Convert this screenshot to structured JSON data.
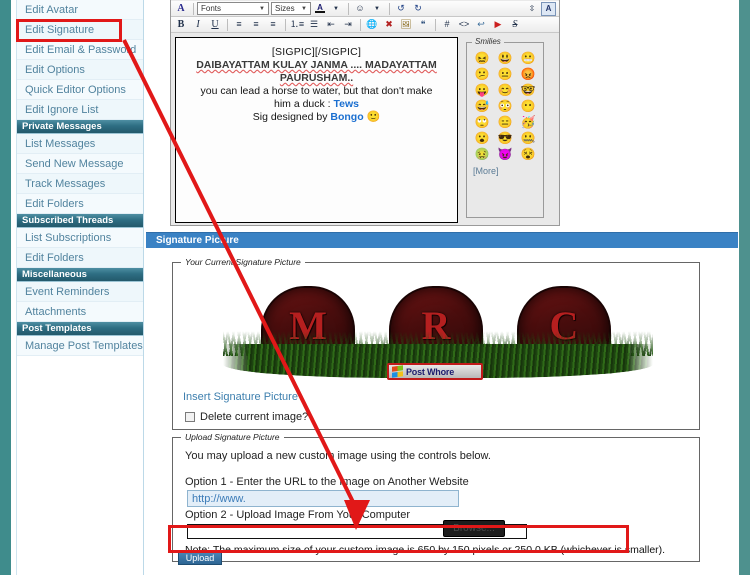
{
  "sidebar": {
    "items": [
      {
        "label": "Edit Avatar",
        "type": "item"
      },
      {
        "label": "Edit Signature",
        "type": "item"
      },
      {
        "label": "Edit Email & Password",
        "type": "item"
      },
      {
        "label": "Edit Options",
        "type": "item"
      },
      {
        "label": "Quick Editor Options",
        "type": "item"
      },
      {
        "label": "Edit Ignore List",
        "type": "item"
      },
      {
        "label": "Private Messages",
        "type": "head"
      },
      {
        "label": "List Messages",
        "type": "item"
      },
      {
        "label": "Send New Message",
        "type": "item"
      },
      {
        "label": "Track Messages",
        "type": "item"
      },
      {
        "label": "Edit Folders",
        "type": "item"
      },
      {
        "label": "Subscribed Threads",
        "type": "head"
      },
      {
        "label": "List Subscriptions",
        "type": "item"
      },
      {
        "label": "Edit Folders",
        "type": "item"
      },
      {
        "label": "Miscellaneous",
        "type": "head"
      },
      {
        "label": "Event Reminders",
        "type": "item"
      },
      {
        "label": "Attachments",
        "type": "item"
      },
      {
        "label": "Post Templates",
        "type": "head"
      },
      {
        "label": "Manage Post Templates",
        "type": "item"
      }
    ]
  },
  "editor": {
    "toolbar_row1": {
      "fonts_label": "Fonts",
      "sizes_label": "Sizes",
      "buttons": [
        {
          "name": "remove-formatting-icon",
          "glyph": "Ⓐ"
        },
        {
          "name": "font-color-icon",
          "glyph": "A"
        },
        {
          "name": "smilie-icon",
          "glyph": "☺"
        },
        {
          "name": "undo-icon",
          "glyph": "↶"
        },
        {
          "name": "redo-icon",
          "glyph": "↷"
        },
        {
          "name": "box-size-stepper-icon",
          "glyph": "↕"
        },
        {
          "name": "wysiwyg-toggle-icon",
          "glyph": "A"
        }
      ]
    },
    "toolbar_row2": {
      "buttons": [
        {
          "name": "bold-icon",
          "glyph": "B"
        },
        {
          "name": "italic-icon",
          "glyph": "I"
        },
        {
          "name": "underline-icon",
          "glyph": "U"
        },
        {
          "name": "align-left-icon",
          "glyph": "≡"
        },
        {
          "name": "align-center-icon",
          "glyph": "≡"
        },
        {
          "name": "align-right-icon",
          "glyph": "≡"
        },
        {
          "name": "ordered-list-icon",
          "glyph": "③"
        },
        {
          "name": "unordered-list-icon",
          "glyph": "☰"
        },
        {
          "name": "outdent-icon",
          "glyph": "⇤"
        },
        {
          "name": "indent-icon",
          "glyph": "⇥"
        },
        {
          "name": "insert-link-icon",
          "glyph": "🌎"
        },
        {
          "name": "remove-link-icon",
          "glyph": "✗"
        },
        {
          "name": "insert-image-icon",
          "glyph": "◱"
        },
        {
          "name": "insert-quote-icon",
          "glyph": "❐"
        },
        {
          "name": "hash-icon",
          "glyph": "#"
        },
        {
          "name": "code-icon",
          "glyph": "<>"
        },
        {
          "name": "wrap-icon",
          "glyph": "↩"
        },
        {
          "name": "youtube-icon",
          "glyph": "▶"
        },
        {
          "name": "strikethrough-icon",
          "glyph": "S"
        }
      ]
    },
    "signature": {
      "line_sigpic": "[SIGPIC][/SIGPIC]",
      "line_quote1": "DAIBAYATTAM KULAY JANMA .... MADAYATTAM",
      "line_quote2": "PAURUSHAM..",
      "line_saying1": "you can lead a horse to water, but that don't make",
      "line_saying2_pre": "him a duck : ",
      "line_saying2_link": "Tews",
      "line_credit_pre": "Sig designed by ",
      "line_credit_link": "Bongo",
      "line_credit_emoji": "🙂"
    },
    "smilies": {
      "legend": "Smilies",
      "more_label": "[More]",
      "glyphs": [
        "😖",
        "😃",
        "😬",
        "😕",
        "😐",
        "😡",
        "😛",
        "😊",
        "🤓",
        "😅",
        "😳",
        "😶",
        "🙄",
        "😑",
        "🥳",
        "😮",
        "😎",
        "🤐",
        "🤢",
        "😈",
        "😵"
      ]
    }
  },
  "sigpic_section": {
    "bar_title": "Signature Picture",
    "current_legend": "Your Current Signature Picture",
    "banner": {
      "tomb_letters": [
        "M",
        "R",
        "C"
      ],
      "badge_label": "Post Whore"
    },
    "insert_link_label": "Insert Signature Picture",
    "delete_label": "Delete current image?",
    "upload_legend": "Upload Signature Picture",
    "upload_desc": "You may upload a new custom image using the controls below.",
    "option1_label": "Option 1 - Enter the URL to the Image on Another Website",
    "url_value": "http://www.",
    "option2_label": "Option 2 - Upload Image From Your Computer",
    "file_value": "",
    "browse_label": "Browse...",
    "note": "Note: The maximum size of your custom image is 650 by 150 pixels or 250.0 KB (whichever is smaller).",
    "upload_button_label": "Upload"
  },
  "annotations": {
    "accent_color": "#e11818",
    "highlight_nav_target": "Edit Signature",
    "highlight_note_target": "Note: The maximum size of your custom image is 650 by 150 pixels or 250.0 KB (whichever is smaller)."
  }
}
